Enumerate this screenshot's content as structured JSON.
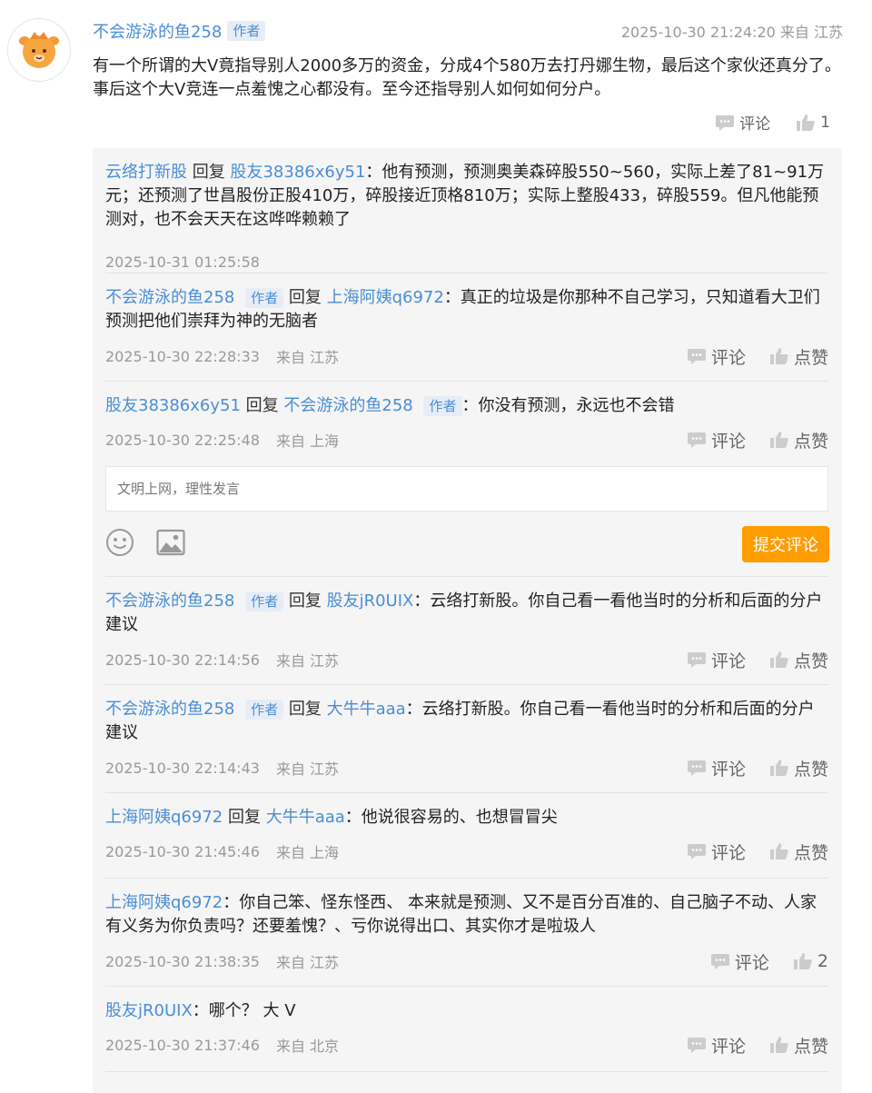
{
  "post": {
    "author": "不会游泳的鱼258",
    "author_badge": "作者",
    "timestamp": "2025-10-30 21:24:20",
    "location": "来自 江苏",
    "text": "有一个所谓的大V竟指导别人2000多万的资金，分成4个580万去打丹娜生物，最后这个家伙还真分了。事后这个大V竞连一点羞愧之心都没有。至今还指导别人如何如何分户。",
    "comment_label": "评论",
    "like_count": "1"
  },
  "replies": [
    {
      "user": "云络打新股",
      "verb": "回复",
      "target": "股友38386x6y51",
      "text": "：他有预测，预测奥美森碎股550~560，实际上差了81~91万元；还预测了世昌股份正股410万，碎股接近顶格810万；实际上整股433，碎股559。但凡他能预测对，也不会天天在这哗哗赖赖了",
      "time": "2025-10-31 01:25:58"
    },
    {
      "user": "不会游泳的鱼258",
      "badge": "作者",
      "verb": "回复",
      "target": "上海阿姨q6972",
      "text": "：真正的垃圾是你那种不自己学习，只知道看大卫们预测把他们崇拜为神的无脑者",
      "time": "2025-10-30 22:28:33",
      "location": "来自 江苏",
      "comment_label": "评论",
      "like_label": "点赞"
    },
    {
      "user": "股友38386x6y51",
      "verb": "回复",
      "target": "不会游泳的鱼258",
      "target_badge": "作者",
      "text": "：你没有预测，永远也不会错",
      "time": "2025-10-30 22:25:48",
      "location": "来自 上海",
      "comment_label": "评论",
      "like_label": "点赞"
    },
    {
      "user": "不会游泳的鱼258",
      "badge": "作者",
      "verb": "回复",
      "target": "股友jR0UIX",
      "text": "：云络打新股。你自己看一看他当时的分析和后面的分户建议",
      "time": "2025-10-30 22:14:56",
      "location": "来自 江苏",
      "comment_label": "评论",
      "like_label": "点赞"
    },
    {
      "user": "不会游泳的鱼258",
      "badge": "作者",
      "verb": "回复",
      "target": "大牛牛aaa",
      "text": "：云络打新股。你自己看一看他当时的分析和后面的分户建议",
      "time": "2025-10-30 22:14:43",
      "location": "来自 江苏",
      "comment_label": "评论",
      "like_label": "点赞"
    },
    {
      "user": "上海阿姨q6972",
      "verb": "回复",
      "target": "大牛牛aaa",
      "text": "：他说很容易的、也想冒冒尖",
      "time": "2025-10-30 21:45:46",
      "location": "来自 上海",
      "comment_label": "评论",
      "like_label": "点赞"
    },
    {
      "user": "上海阿姨q6972",
      "text": "：你自己笨、怪东怪西、 本来就是预测、又不是百分百准的、自己脑子不动、人家有义务为你负责吗？还要羞愧？、亏你说得出口、其实你才是啦圾人",
      "time": "2025-10-30 21:38:35",
      "location": "来自 江苏",
      "comment_label": "评论",
      "like_label": "2"
    },
    {
      "user": "股友jR0UIX",
      "text": "：哪个？ 大 V",
      "time": "2025-10-30 21:37:46",
      "location": "来自 北京",
      "comment_label": "评论",
      "like_label": "点赞"
    }
  ],
  "composer": {
    "placeholder": "文明上网，理性发言",
    "submit_label": "提交评论"
  },
  "colors": {
    "link": "#4a8ed6",
    "submit": "#ff9c00",
    "meta": "#999999"
  },
  "icons": [
    "avatar-icon",
    "comment-icon",
    "like-icon",
    "emoji-icon",
    "image-icon"
  ]
}
